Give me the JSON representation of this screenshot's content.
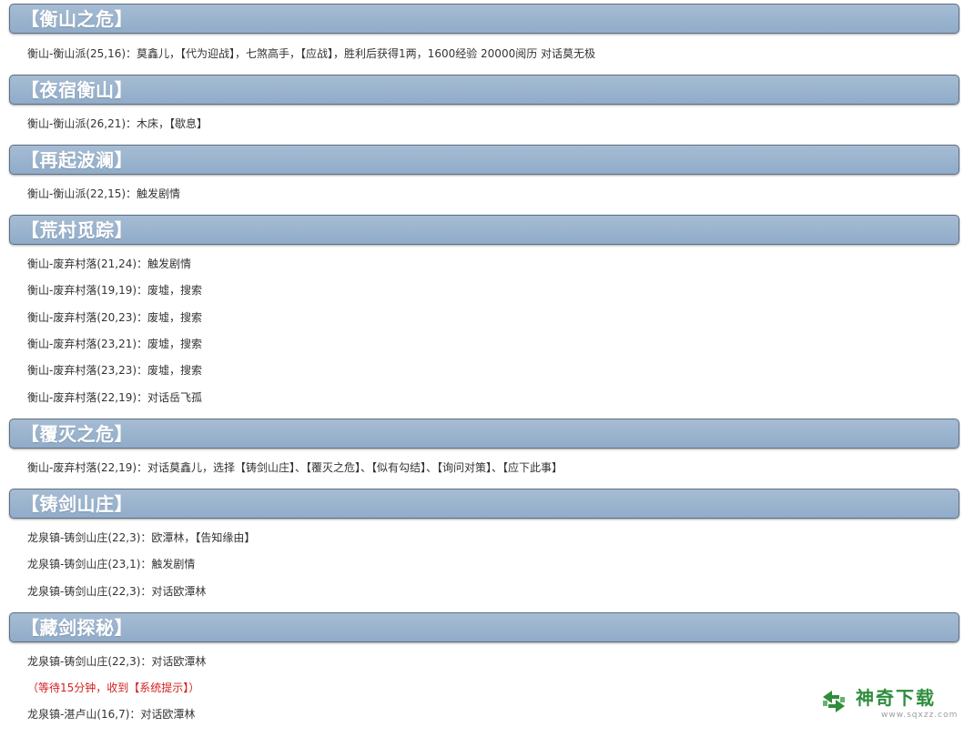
{
  "sections": [
    {
      "title": "【衡山之危】",
      "lines": [
        {
          "text": "衡山-衡山派(25,16)：莫鑫儿，【代为迎战】，七煞高手，【应战】，胜利后获得1两，1600经验 20000阅历 对话莫无极"
        }
      ]
    },
    {
      "title": "【夜宿衡山】",
      "lines": [
        {
          "text": "衡山-衡山派(26,21)：木床，【歇息】"
        }
      ]
    },
    {
      "title": "【再起波澜】",
      "lines": [
        {
          "text": "衡山-衡山派(22,15)：触发剧情"
        }
      ]
    },
    {
      "title": "【荒村觅踪】",
      "lines": [
        {
          "text": "衡山-废弃村落(21,24)：触发剧情"
        },
        {
          "text": "衡山-废弃村落(19,19)：废墟，搜索"
        },
        {
          "text": "衡山-废弃村落(20,23)：废墟，搜索"
        },
        {
          "text": "衡山-废弃村落(23,21)：废墟，搜索"
        },
        {
          "text": "衡山-废弃村落(23,23)：废墟，搜索"
        },
        {
          "text": "衡山-废弃村落(22,19)：对话岳飞孤"
        }
      ]
    },
    {
      "title": "【覆灭之危】",
      "lines": [
        {
          "text": "衡山-废弃村落(22,19)：对话莫鑫儿，选择【铸剑山庄】、【覆灭之危】、【似有勾结】、【询问对策】、【应下此事】"
        }
      ]
    },
    {
      "title": "【铸剑山庄】",
      "lines": [
        {
          "text": "龙泉镇-铸剑山庄(22,3)：欧潭林，【告知缘由】"
        },
        {
          "text": "龙泉镇-铸剑山庄(23,1)：触发剧情"
        },
        {
          "text": "龙泉镇-铸剑山庄(22,3)：对话欧潭林"
        }
      ]
    },
    {
      "title": "【藏剑探秘】",
      "lines": [
        {
          "text": "龙泉镇-铸剑山庄(22,3)：对话欧潭林"
        },
        {
          "text": "（等待15分钟，收到【系统提示】）",
          "color": "red"
        },
        {
          "text": "龙泉镇-湛卢山(16,7)：对话欧潭林"
        }
      ]
    }
  ],
  "watermark": {
    "brand": "神奇下载",
    "url": "www.sqxzz.com",
    "icon": "recycle-arrows-icon",
    "color": "#2f8d3d"
  }
}
